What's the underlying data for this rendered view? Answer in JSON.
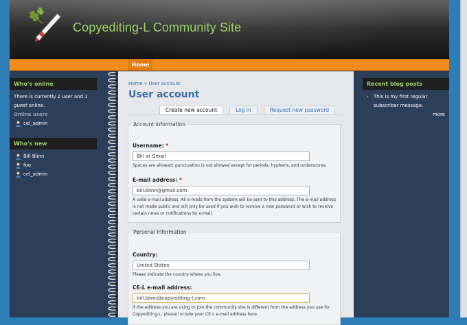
{
  "header": {
    "site_name": "Copyediting-L Community Site"
  },
  "nav": {
    "home_label": "Home"
  },
  "left_sidebar": {
    "whos_online": {
      "title": "Who's online",
      "text_before": "There is currently ",
      "count_users": "1 user",
      "text_mid": " and ",
      "count_guests": "1 guest",
      "text_after": " online.",
      "online_users_label": "Online users",
      "users": [
        "cel_admin"
      ]
    },
    "whos_new": {
      "title": "Who's new",
      "users": [
        "Bill Blinn",
        "foo",
        "cel_admin"
      ]
    }
  },
  "right_sidebar": {
    "title": "Recent blog posts",
    "posts": [
      "This is my first regular subscriber message."
    ],
    "more_label": "more"
  },
  "content": {
    "breadcrumb": [
      "Home",
      "User account"
    ],
    "breadcrumb_sep": "»",
    "title": "User account",
    "tabs": [
      {
        "label": "Create new account",
        "active": true
      },
      {
        "label": "Log in",
        "active": false
      },
      {
        "label": "Request new password",
        "active": false
      }
    ],
    "account_info": {
      "legend": "Account information",
      "username_label": "Username:",
      "username_value": "Bill at Gmail",
      "username_desc": "Spaces are allowed; punctuation is not allowed except for periods, hyphens, and underscores.",
      "email_label": "E-mail address:",
      "email_value": "bill.blinn@gmail.com",
      "email_desc": "A valid e-mail address. All e-mails from the system will be sent to this address. The e-mail address is not made public and will only be used if you wish to receive a new password or wish to receive certain news or notifications by e-mail.",
      "required_mark": "*"
    },
    "personal_info": {
      "legend": "Personal Information",
      "country_label": "Country:",
      "country_value": "United States",
      "country_desc": "Please indicate the country where you live.",
      "cel_email_label": "CE-L e-mail address:",
      "cel_email_value": "bill.blinn@copyediting-l.com",
      "cel_email_desc": "If the address you are using to join the community site is different from the address you use for Copyediting-L, please include your CE-L e-mail address here."
    }
  }
}
